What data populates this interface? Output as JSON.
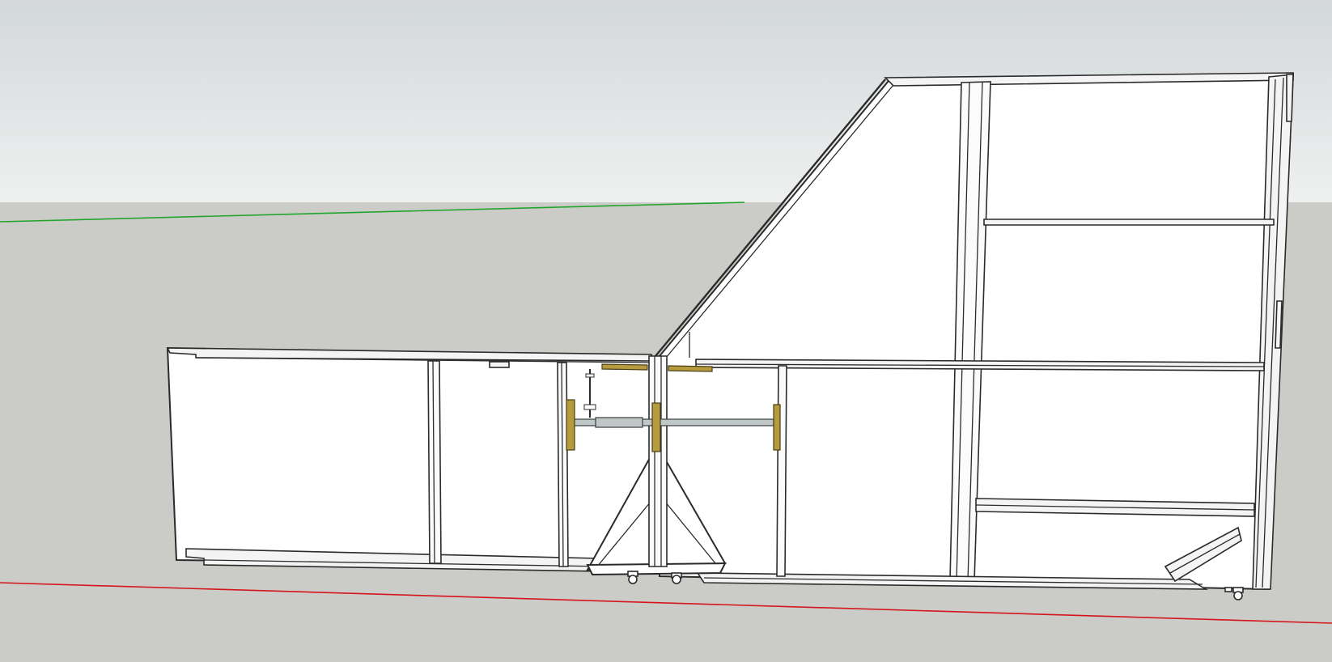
{
  "viewport": {
    "sky_top_color": "#d3d8da",
    "sky_bottom_color": "#eff0f0",
    "ground_color": "#cbcbc7",
    "green_axis_color": "#22a52c",
    "red_axis_color": "#d4151b",
    "model_fill_color": "#ffffff",
    "edge_color": "#2b2b2b",
    "bracket_color": "#b59a3e",
    "steel_color": "#bfc7c7"
  },
  "model": {
    "left_wing_studs": 3,
    "right_tall_panel_shelves": 4,
    "casters_visible": 4
  }
}
